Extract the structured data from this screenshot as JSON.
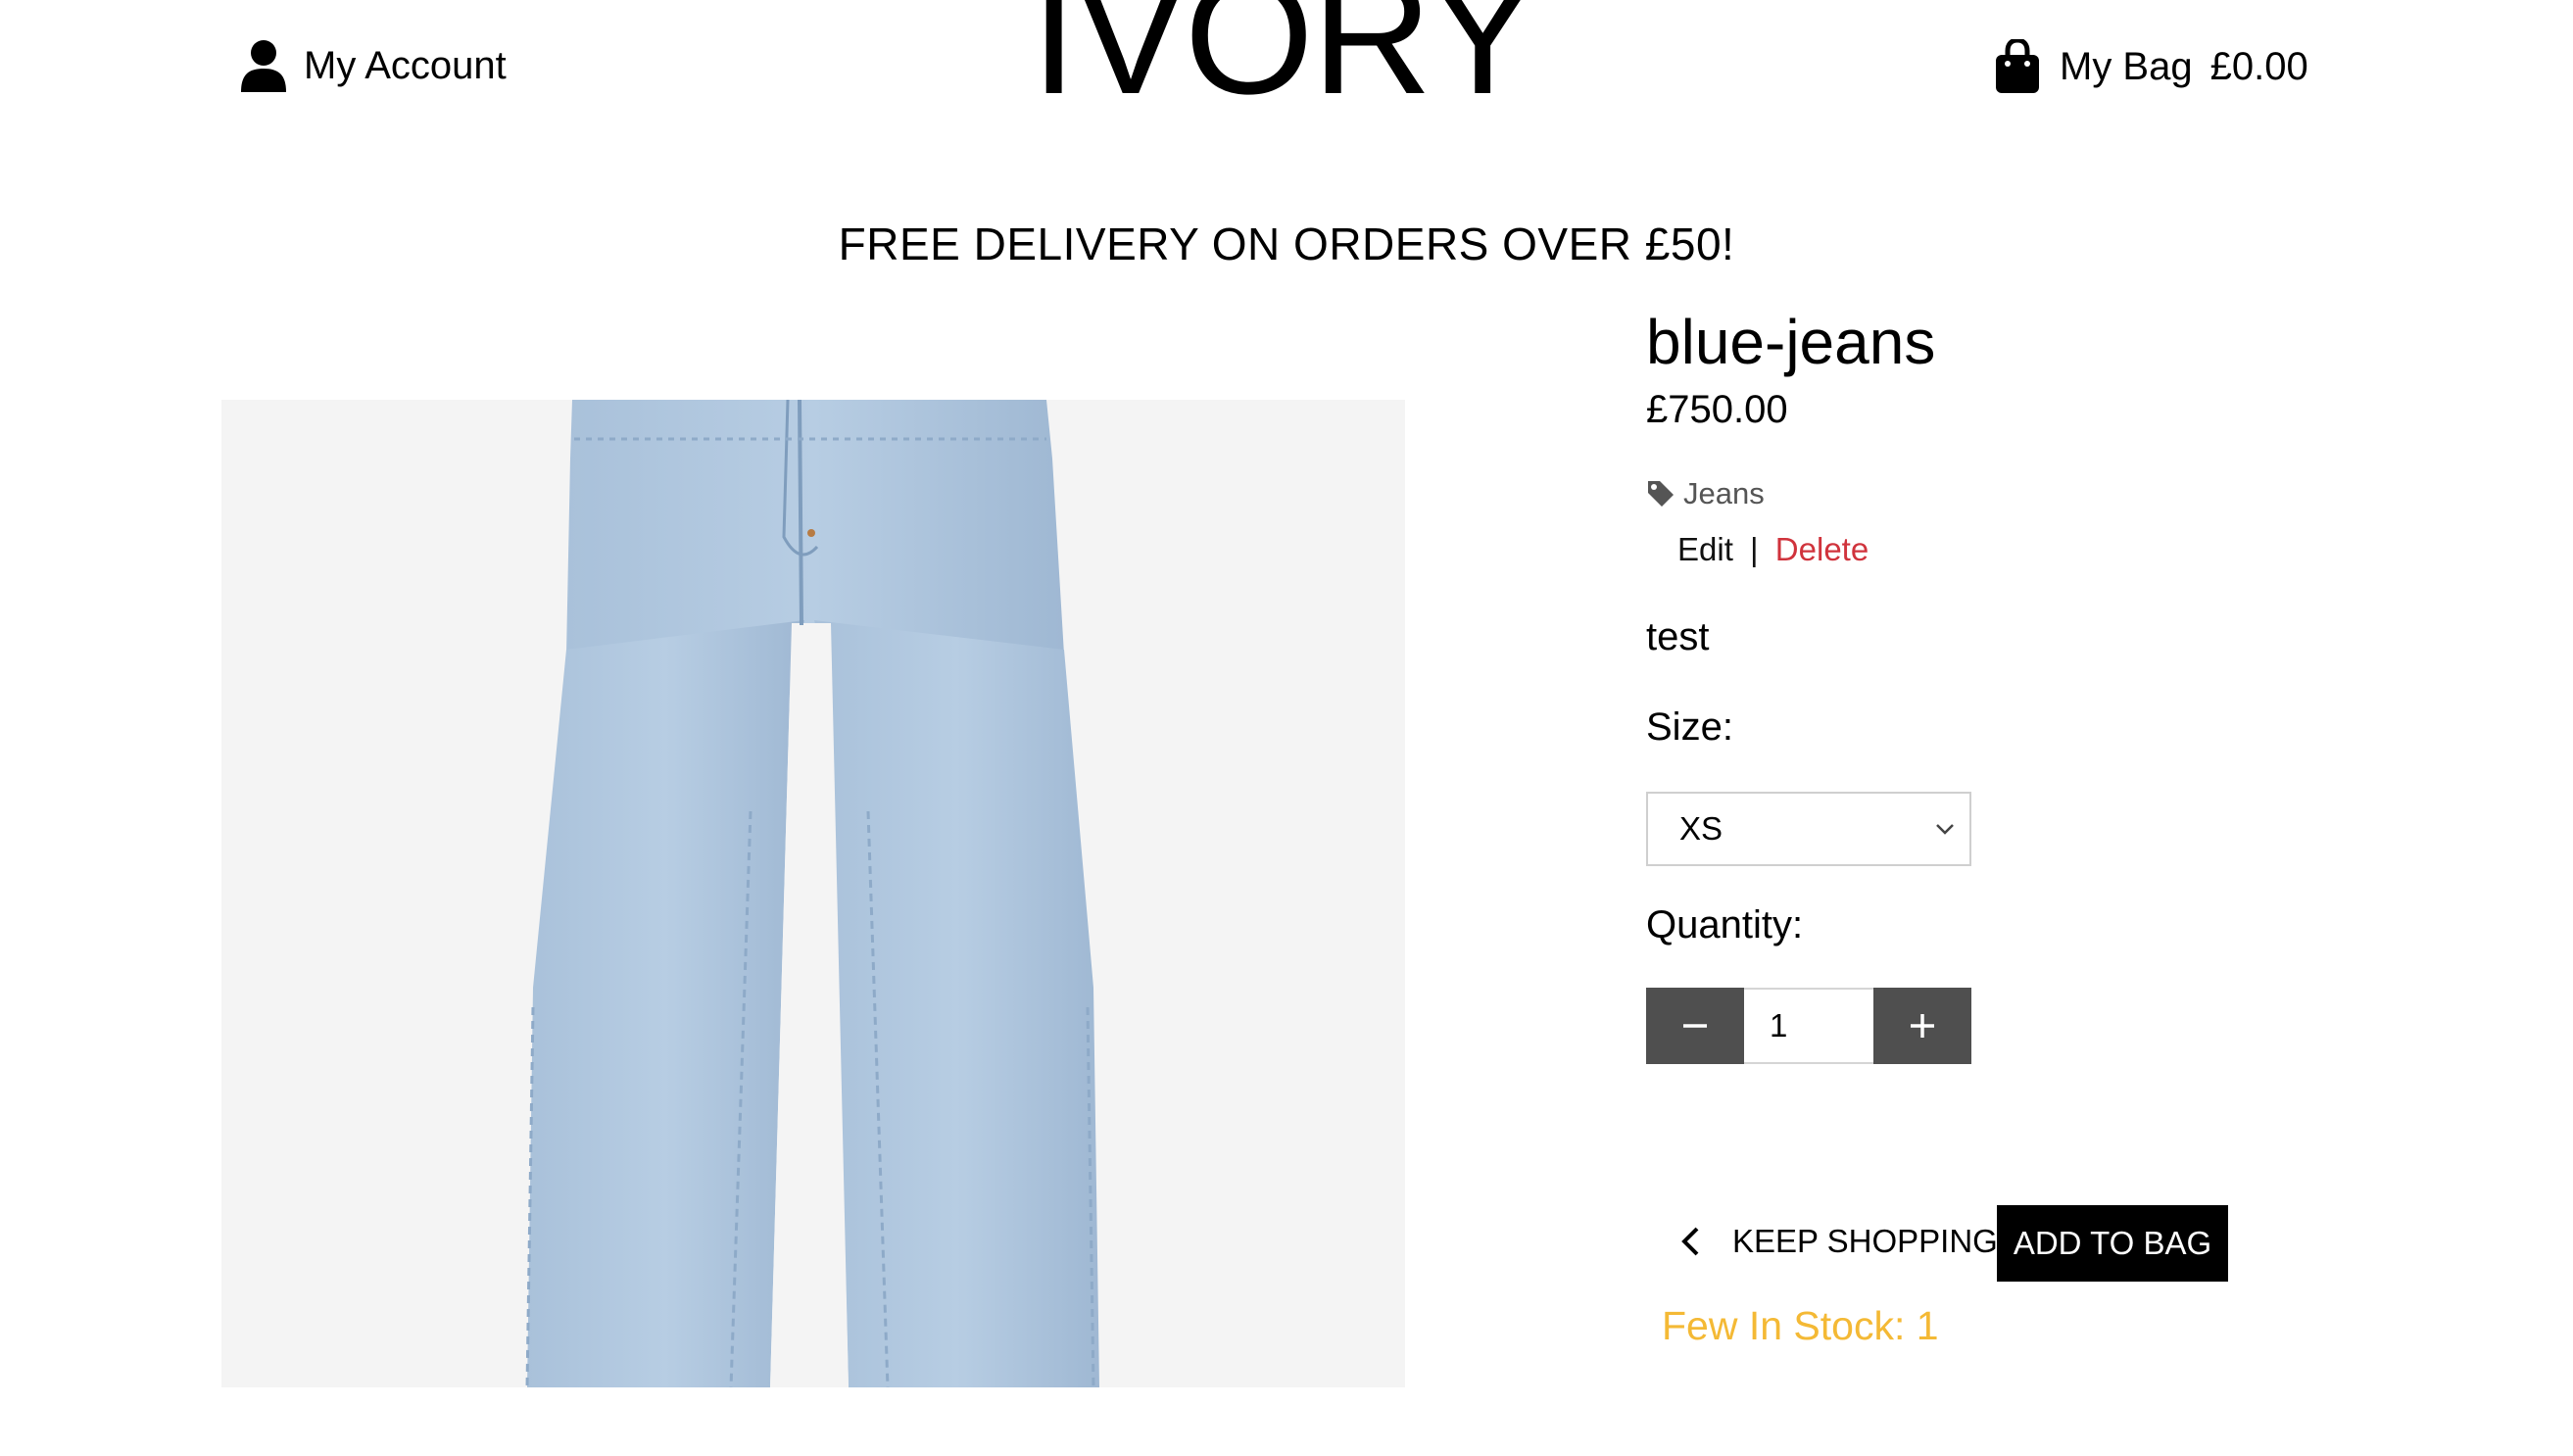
{
  "header": {
    "account_label": "My Account",
    "brand": "IVORY",
    "bag_label": "My Bag",
    "bag_total": "£0.00"
  },
  "promo": {
    "text": "FREE DELIVERY ON ORDERS OVER £50!"
  },
  "product": {
    "name": "blue-jeans",
    "price": "£750.00",
    "category": "Jeans",
    "description": "test",
    "image_icon": "jeans-photo"
  },
  "admin": {
    "edit_label": "Edit",
    "separator": "|",
    "delete_label": "Delete"
  },
  "form": {
    "size_label": "Size:",
    "size_selected": "XS",
    "quantity_label": "Quantity:",
    "quantity_value": "1"
  },
  "actions": {
    "keep_shopping_label": "KEEP SHOPPING",
    "add_to_bag_label": "ADD TO BAG"
  },
  "stock": {
    "text": "Few In Stock: 1"
  },
  "colors": {
    "delete": "#d0333c",
    "stock_warning": "#f4b935",
    "qty_button": "#4f4f4f",
    "cta": "#000000"
  }
}
